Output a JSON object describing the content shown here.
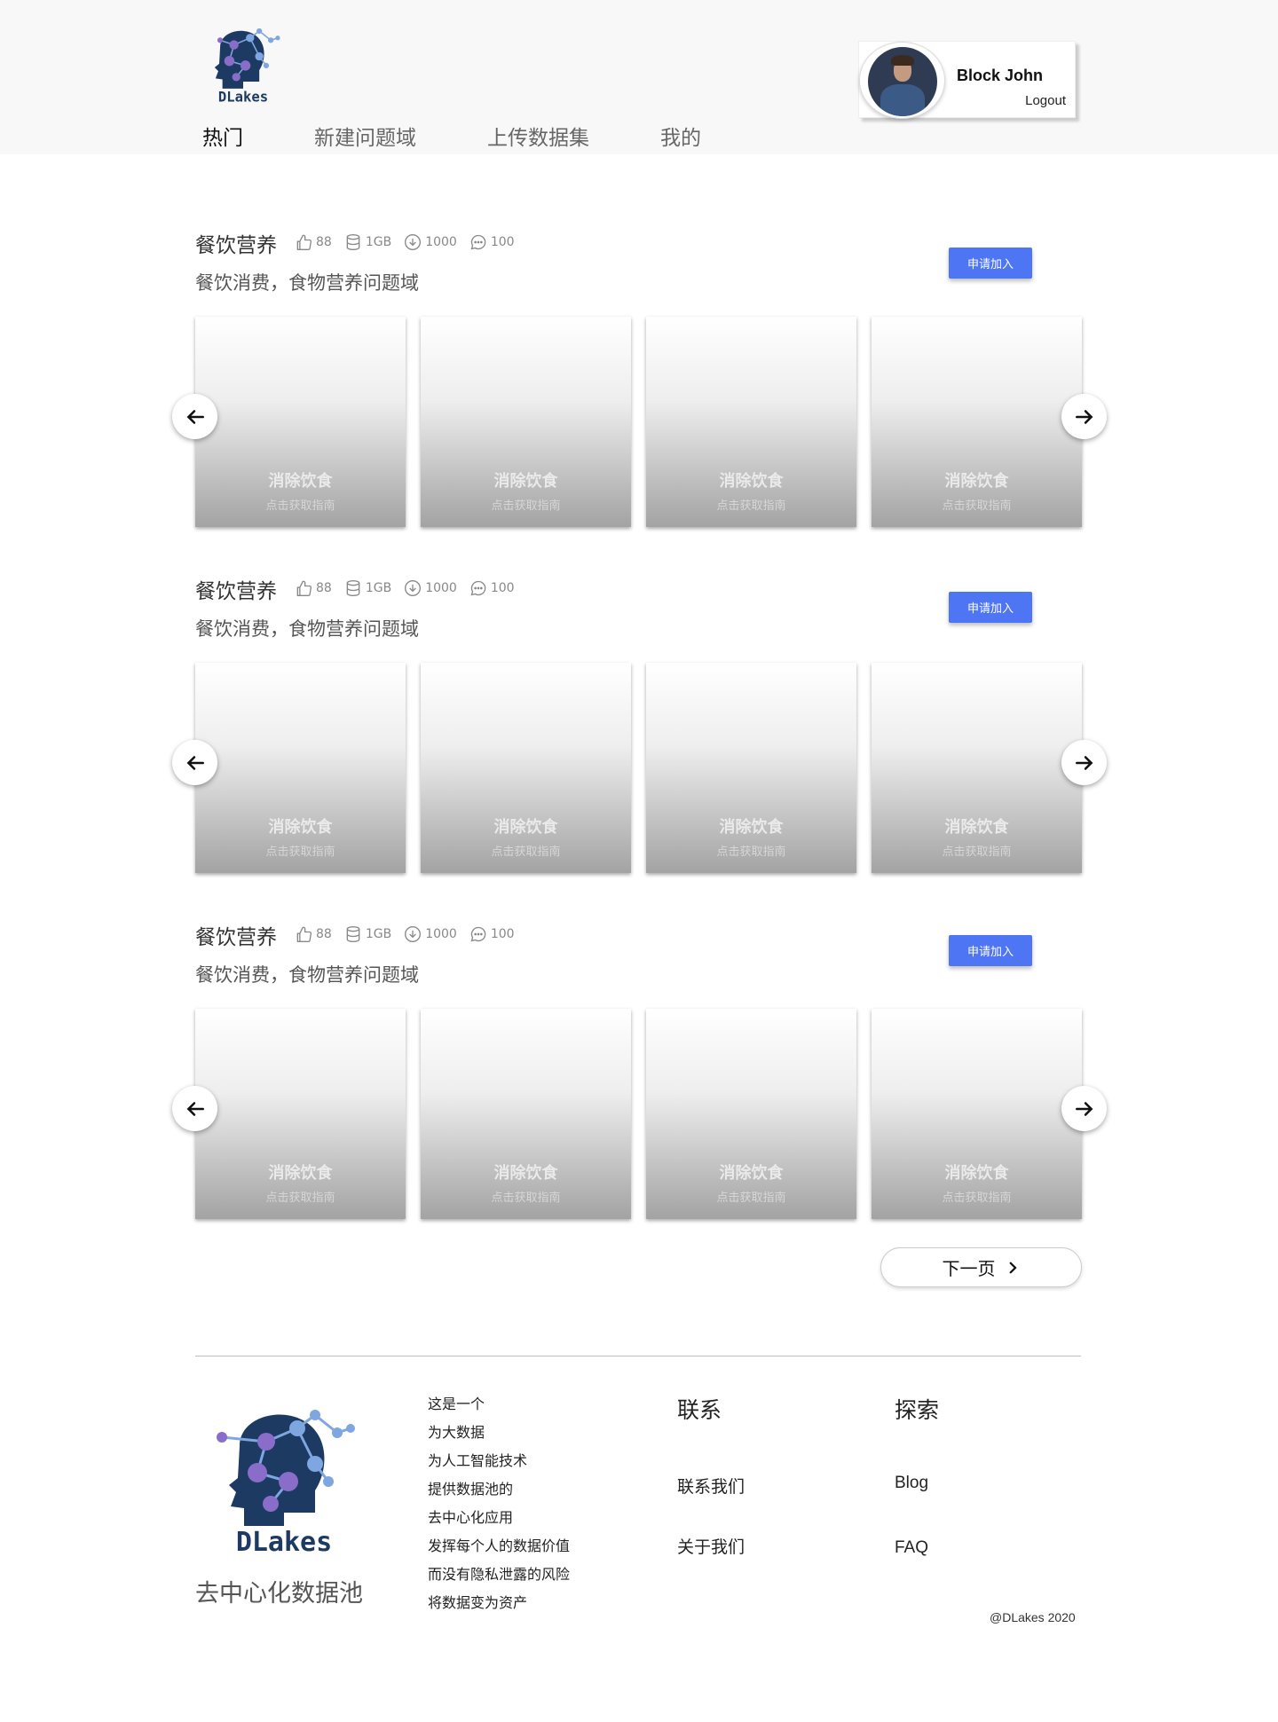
{
  "header": {
    "logo_text": "DLakes",
    "nav": [
      "热门",
      "新建问题域",
      "上传数据集",
      "我的"
    ],
    "user": {
      "name": "Block John",
      "logout": "Logout"
    }
  },
  "sections": [
    {
      "title": "餐饮营养",
      "stats": {
        "likes": "88",
        "size": "1GB",
        "downloads": "1000",
        "comments": "100"
      },
      "description": "餐饮消费，食物营养问题域",
      "join_label": "申请加入",
      "cards": [
        {
          "title": "消除饮食",
          "subtitle": "点击获取指南"
        },
        {
          "title": "消除饮食",
          "subtitle": "点击获取指南"
        },
        {
          "title": "消除饮食",
          "subtitle": "点击获取指南"
        },
        {
          "title": "消除饮食",
          "subtitle": "点击获取指南"
        }
      ]
    },
    {
      "title": "餐饮营养",
      "stats": {
        "likes": "88",
        "size": "1GB",
        "downloads": "1000",
        "comments": "100"
      },
      "description": "餐饮消费，食物营养问题域",
      "join_label": "申请加入",
      "cards": [
        {
          "title": "消除饮食",
          "subtitle": "点击获取指南"
        },
        {
          "title": "消除饮食",
          "subtitle": "点击获取指南"
        },
        {
          "title": "消除饮食",
          "subtitle": "点击获取指南"
        },
        {
          "title": "消除饮食",
          "subtitle": "点击获取指南"
        }
      ]
    },
    {
      "title": "餐饮营养",
      "stats": {
        "likes": "88",
        "size": "1GB",
        "downloads": "1000",
        "comments": "100"
      },
      "description": "餐饮消费，食物营养问题域",
      "join_label": "申请加入",
      "cards": [
        {
          "title": "消除饮食",
          "subtitle": "点击获取指南"
        },
        {
          "title": "消除饮食",
          "subtitle": "点击获取指南"
        },
        {
          "title": "消除饮食",
          "subtitle": "点击获取指南"
        },
        {
          "title": "消除饮食",
          "subtitle": "点击获取指南"
        }
      ]
    }
  ],
  "pagination": {
    "next_label": "下一页"
  },
  "footer": {
    "logo_text": "DLakes",
    "slogan": "去中心化数据池",
    "about_lines": [
      "这是一个",
      "为大数据",
      "为人工智能技术",
      "提供数据池的",
      "去中心化应用",
      "发挥每个人的数据价值",
      "而没有隐私泄露的风险",
      "将数据变为资产"
    ],
    "contact": {
      "title": "联系",
      "links": [
        "联系我们",
        "关于我们"
      ]
    },
    "explore": {
      "title": "探索",
      "links": [
        "Blog",
        "FAQ"
      ]
    },
    "copyright": "@DLakes 2020"
  },
  "colors": {
    "accent": "#4e75f4",
    "logo_navy": "#1d3a63",
    "logo_purple": "#8a6cc9",
    "logo_blue": "#7ea6e0"
  },
  "icons": [
    "thumbs-up-icon",
    "database-icon",
    "download-icon",
    "comment-icon",
    "arrow-left-icon",
    "arrow-right-icon",
    "chevron-right-icon"
  ]
}
